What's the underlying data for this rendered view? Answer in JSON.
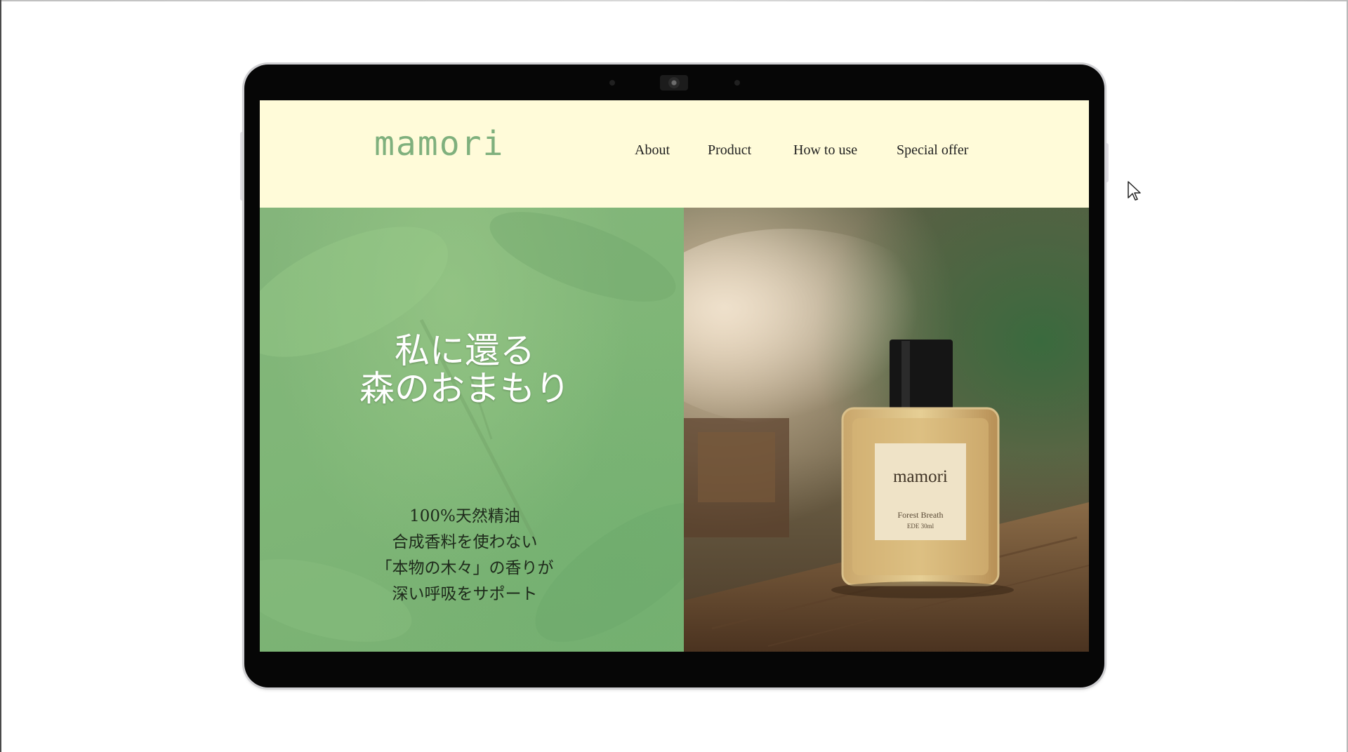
{
  "site": {
    "logo": "mamori",
    "nav": [
      "About",
      "Product",
      "How to use",
      "Special offer"
    ]
  },
  "hero": {
    "headline_line1": "私に還る",
    "headline_line2": "森のおまもり",
    "copy_lines": [
      "100%天然精油",
      "合成香料を使わない",
      "「本物の木々」の香りが",
      "深い呼吸をサポート"
    ],
    "product_image": {
      "bottle_brand": "mamori",
      "bottle_name": "Forest Breath",
      "bottle_sub": "EDE 30ml"
    }
  },
  "colors": {
    "header_bg": "#fffbd9",
    "logo_green": "#7fb07d",
    "hero_green": "#80b478",
    "device_frame": "#060606"
  },
  "icons": [
    "camera-icon",
    "mouse-cursor-icon"
  ]
}
